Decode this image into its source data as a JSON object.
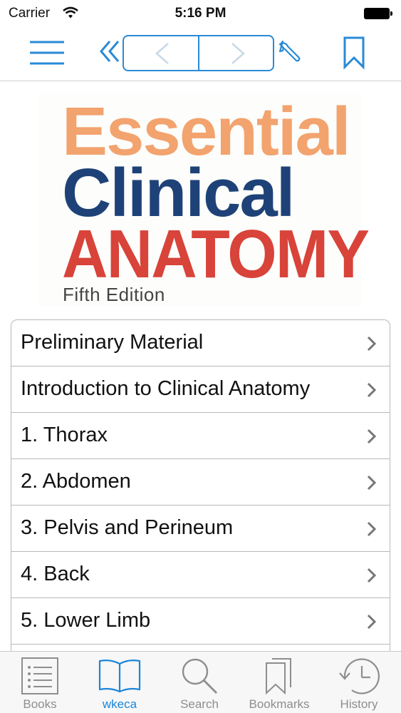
{
  "status_bar": {
    "carrier": "Carrier",
    "time": "5:16 PM"
  },
  "toolbar": {
    "icons": [
      "menu-icon",
      "double-chevron-left-icon",
      "chevron-left-icon",
      "chevron-right-icon",
      "wrench-icon",
      "bookmark-icon"
    ],
    "accent_color": "#2a8ad6"
  },
  "cover": {
    "line1": "Essential",
    "line2": "Clinical",
    "line3": "ANATOMY",
    "edition": "Fifth Edition",
    "colors": {
      "line1": "#f2a36e",
      "line2": "#1e4278",
      "line3": "#d8433a"
    }
  },
  "toc": {
    "items": [
      {
        "label": "Preliminary Material"
      },
      {
        "label": "Introduction to Clinical Anatomy"
      },
      {
        "label": "1. Thorax"
      },
      {
        "label": "2. Abdomen"
      },
      {
        "label": "3. Pelvis and Perineum"
      },
      {
        "label": "4. Back"
      },
      {
        "label": "5. Lower Limb"
      }
    ]
  },
  "tab_bar": {
    "active_color": "#1a86d9",
    "tabs": [
      {
        "label": "Books",
        "icon": "list-icon"
      },
      {
        "label": "wkeca",
        "icon": "open-book-icon",
        "active": true
      },
      {
        "label": "Search",
        "icon": "magnifier-icon"
      },
      {
        "label": "Bookmarks",
        "icon": "bookmarks-icon"
      },
      {
        "label": "History",
        "icon": "clock-icon"
      }
    ]
  }
}
